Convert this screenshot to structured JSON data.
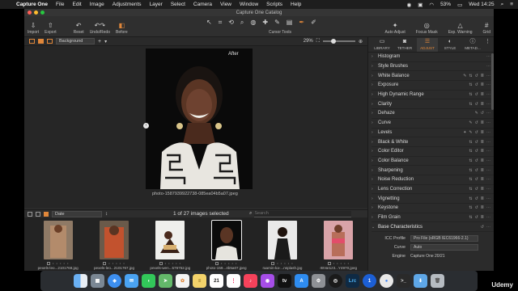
{
  "menubar": {
    "app_name": "Capture One",
    "items": [
      "File",
      "Edit",
      "Image",
      "Adjustments",
      "Layer",
      "Select",
      "Camera",
      "View",
      "Window",
      "Scripts",
      "Help"
    ],
    "battery": "53%",
    "clock": "Wed 14:25"
  },
  "window": {
    "title": "Capture One Catalog"
  },
  "toolbar": {
    "left": [
      {
        "label": "Import",
        "icon": "import-icon"
      },
      {
        "label": "Export",
        "icon": "export-icon"
      },
      {
        "label": "Reset",
        "icon": "reset-icon"
      },
      {
        "label": "Undo/Redo",
        "icon": "undo-icon"
      },
      {
        "label": "Before",
        "icon": "before-icon"
      }
    ],
    "cursor_tools_label": "Cursor Tools",
    "right": [
      "Auto Adjust",
      "Focus Mask",
      "Exp. Warning",
      "Grid"
    ]
  },
  "viewer": {
    "background_select": "Background",
    "zoom": "29%",
    "after_label": "After",
    "filename": "photo-1587939922738-085ea04b5a07.jpeg"
  },
  "browser": {
    "sort": "Date",
    "selection_status": "1 of 27 images selected",
    "search_placeholder": "Search",
    "thumbnails": [
      {
        "name": "pexels-leo...2101768.jpg",
        "selected": false
      },
      {
        "name": "pexels-leo...2101767.jpg",
        "selected": false
      },
      {
        "name": "pexels-wen...576752.jpg",
        "selected": false
      },
      {
        "name": "photo-159...4b5a07.jpeg",
        "selected": true
      },
      {
        "name": "raamin-ka-...nsplash.jpg",
        "selected": false
      },
      {
        "name": "rBVaI1z3...Y4970.jpeg",
        "selected": false
      }
    ]
  },
  "panel": {
    "tabs": [
      {
        "label": "LIBRARY",
        "icon": "folder-icon",
        "active": false
      },
      {
        "label": "TETHER",
        "icon": "camera-icon",
        "active": false
      },
      {
        "label": "ADJUST",
        "icon": "sliders-icon",
        "active": true
      },
      {
        "label": "STYLE",
        "icon": "palette-icon",
        "active": false
      },
      {
        "label": "METAD...",
        "icon": "info-icon",
        "active": false
      }
    ],
    "tools": [
      "Histogram",
      "Style Brushes",
      "White Balance",
      "Exposure",
      "High Dynamic Range",
      "Clarity",
      "Dehaze",
      "Curve",
      "Levels",
      "Black & White",
      "Color Editor",
      "Color Balance",
      "Sharpening",
      "Noise Reduction",
      "Lens Correction",
      "Vignetting",
      "Keystone",
      "Film Grain",
      "Base Characteristics"
    ],
    "base_characteristics": {
      "icc_label": "ICC Profile",
      "icc_value": "Pro File (sRGB IEC61966-2.1)",
      "curve_label": "Curve",
      "curve_value": "Auto",
      "engine_label": "Engine",
      "engine_value": "Capture One 20/21"
    }
  },
  "dock": {
    "apps": [
      "Finder",
      "Launchpad",
      "Safari",
      "Mail",
      "Messages",
      "Maps",
      "Photos",
      "Notes",
      "Calendar",
      "Reminders",
      "Music",
      "Podcasts",
      "TV",
      "App Store",
      "System Preferences",
      "Capture One",
      "Lightroom",
      "1Password",
      "Chrome",
      "Terminal",
      "Downloads",
      "Trash"
    ],
    "calendar_day": "21",
    "lightroom_label": "Lrc"
  },
  "watermark": "Udemy"
}
